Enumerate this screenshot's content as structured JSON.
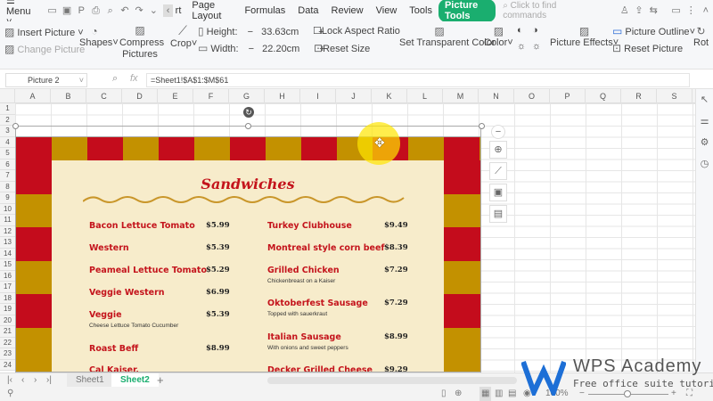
{
  "menubar": {
    "menu": "Menu",
    "tabs": [
      "rt",
      "Page Layout",
      "Formulas",
      "Data",
      "Review",
      "View",
      "Tools"
    ],
    "active_tab": "Picture Tools",
    "search": "Click to find commands"
  },
  "ribbon": {
    "insert_picture": "Insert Picture",
    "change_picture": "Change Picture",
    "shapes": "Shapes",
    "compress": "Compress Pictures",
    "crop": "Crop",
    "height_label": "Height:",
    "height_value": "33.63cm",
    "width_label": "Width:",
    "width_value": "22.20cm",
    "lock_aspect": "Lock Aspect Ratio",
    "reset_size": "Reset Size",
    "set_transparent": "Set Transparent Color",
    "color": "Color",
    "picture_effects": "Picture Effects",
    "picture_outline": "Picture Outline",
    "reset_picture": "Reset Picture",
    "rotate": "Rot"
  },
  "formula_bar": {
    "name_box": "Picture 2",
    "fx": "fx",
    "formula": "=Sheet1!$A$1:$M$61"
  },
  "columns": [
    "A",
    "B",
    "C",
    "D",
    "E",
    "F",
    "G",
    "H",
    "I",
    "J",
    "K",
    "L",
    "M",
    "N",
    "O",
    "P",
    "Q",
    "R",
    "S"
  ],
  "menu": {
    "title": "Sandwiches",
    "left": [
      {
        "name": "Bacon Lettuce Tomato",
        "price": "$5.99",
        "desc": ""
      },
      {
        "name": "Western",
        "price": "$5.39",
        "desc": ""
      },
      {
        "name": "Peameal Lettuce Tomato",
        "price": "$5.29",
        "desc": ""
      },
      {
        "name": "Veggie Western",
        "price": "$6.99",
        "desc": ""
      },
      {
        "name": "Veggie",
        "price": "$5.39",
        "desc": "Cheese Lettuce Tomato Cucumber"
      },
      {
        "name": "Roast Beff",
        "price": "$8.99",
        "desc": ""
      },
      {
        "name": "Cal Kaiser.",
        "price": "",
        "desc": ""
      }
    ],
    "right": [
      {
        "name": "Turkey Clubhouse",
        "price": "$9.49",
        "desc": ""
      },
      {
        "name": "Montreal style corn beef",
        "price": "$8.39",
        "desc": ""
      },
      {
        "name": "Grilled Chicken",
        "price": "$7.29",
        "desc": "Chickenbreast on a Kaiser"
      },
      {
        "name": "Oktoberfest Sausage",
        "price": "$7.29",
        "desc": "Topped with sauerkraut"
      },
      {
        "name": "Italian Sausage",
        "price": "$8.99",
        "desc": "With onions and sweet peppers"
      },
      {
        "name": "Decker Grilled Cheese",
        "price": "$9.29",
        "desc": ""
      }
    ]
  },
  "sheets": {
    "tabs": [
      "Sheet1",
      "Sheet2"
    ],
    "active": "Sheet2"
  },
  "status": {
    "zoom": "100%"
  },
  "watermark": {
    "brand": "WPS Academy",
    "tagline": "Free office suite tutorials"
  },
  "colors": {
    "accent": "#1aae6f",
    "red": "#c40c1c",
    "gold": "#c39100",
    "cream": "#f7eccb"
  }
}
